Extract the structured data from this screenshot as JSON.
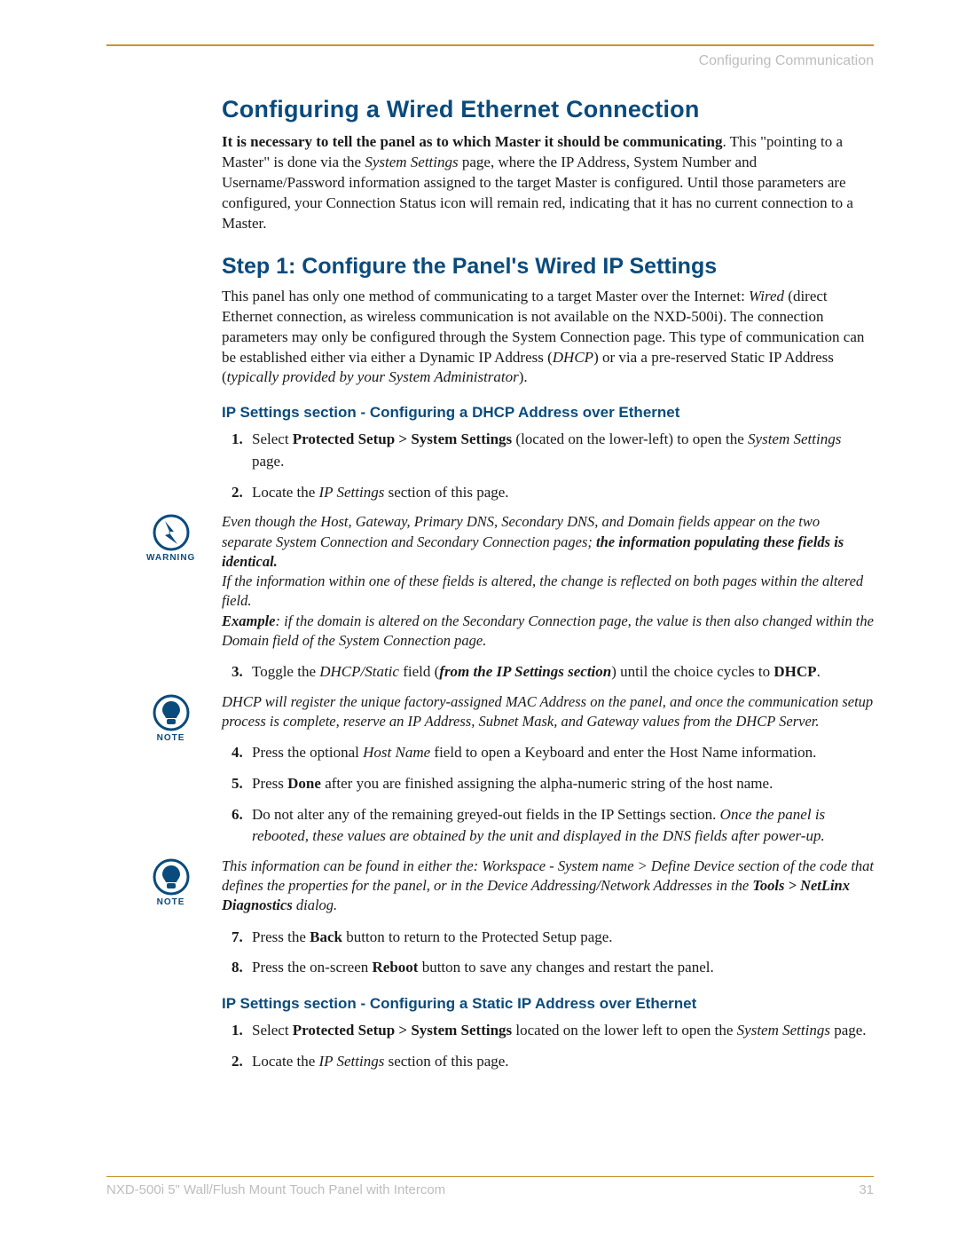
{
  "header": {
    "section": "Configuring Communication"
  },
  "h1": "Configuring a Wired Ethernet Connection",
  "p1_a": "It is necessary to tell the panel as to which Master it should be communicating",
  "p1_b": ". This \"pointing to a Master\" is done via the ",
  "p1_c": "System Settings",
  "p1_d": " page, where the IP Address, System Number and Username/Password information assigned to the target Master is configured. Until those parameters are configured, your Connection Status icon will remain red, indicating that it has no current connection to a Master.",
  "h2": "Step 1: Configure the Panel's Wired IP Settings",
  "p2_a": "This panel has only one method of communicating to a target Master over the Internet: ",
  "p2_b": "Wired",
  "p2_c": " (direct Ethernet connection, as wireless communication is not available on the NXD-500i). The connection parameters may only be configured through the System Connection page. This type of communication can be established either via either a Dynamic IP Address (",
  "p2_d": "DHCP",
  "p2_e": ") or via a pre-reserved Static IP Address (",
  "p2_f": "typically provided by your System Administrator",
  "p2_g": ").",
  "h3a": "IP Settings section - Configuring a DHCP Address over Ethernet",
  "dhcp": {
    "s1_a": "Select ",
    "s1_b": "Protected Setup > System Settings",
    "s1_c": " (located on the lower-left) to open the ",
    "s1_d": "System Settings",
    "s1_e": " page.",
    "s2_a": "Locate the ",
    "s2_b": "IP Settings",
    "s2_c": " section of this page.",
    "s3_a": "Toggle the ",
    "s3_b": "DHCP/Static",
    "s3_c": " field (",
    "s3_d": "from the IP Settings section",
    "s3_e": ") until the choice cycles to ",
    "s3_f": "DHCP",
    "s3_g": ".",
    "s4_a": "Press the optional ",
    "s4_b": "Host Name",
    "s4_c": " field to open a Keyboard and enter the Host Name information.",
    "s5_a": "Press ",
    "s5_b": "Done",
    "s5_c": " after you are finished assigning the alpha-numeric string of the host name.",
    "s6_a": "Do not alter any of the remaining greyed-out fields in the IP Settings section. ",
    "s6_b": "Once the panel is rebooted, these values are obtained by the unit and displayed in the DNS fields after power-up.",
    "s7_a": "Press the ",
    "s7_b": "Back",
    "s7_c": " button to return to the Protected Setup page.",
    "s8_a": "Press the on-screen ",
    "s8_b": "Reboot",
    "s8_c": " button to save any changes and restart the panel."
  },
  "warning": {
    "label": "WARNING",
    "line1": "Even though the Host, Gateway, Primary DNS, Secondary DNS, and Domain fields appear on the two separate System Connection and Secondary Connection pages; ",
    "line1b": "the information populating these fields is identical.",
    "line2": "If the information within one of these fields is altered, the change is reflected on both pages within the altered field.",
    "line3a": "Example",
    "line3b": ": if the domain is altered on the Secondary Connection page, the value is then also changed within the Domain field of the System Connection page."
  },
  "note1": {
    "label": "NOTE",
    "text": "DHCP will register the unique factory-assigned MAC Address on the panel, and once the communication setup process is complete, reserve an IP Address, Subnet Mask, and Gateway values from the DHCP Server."
  },
  "note2": {
    "label": "NOTE",
    "text_a": "This information can be found in either the: Workspace - System name > Define Device section of the code that defines the properties for the panel, or in the Device Addressing/Network Addresses in the ",
    "text_b": "Tools > NetLinx Diagnostics",
    "text_c": " dialog."
  },
  "h3b": "IP Settings section - Configuring a Static IP Address over Ethernet",
  "staticip": {
    "s1_a": "Select ",
    "s1_b": "Protected Setup > System Settings",
    "s1_c": " located on the lower left to open the ",
    "s1_d": "System Settings",
    "s1_e": " page.",
    "s2_a": "Locate the ",
    "s2_b": "IP Settings",
    "s2_c": " section of this page."
  },
  "footer": {
    "left": "NXD-500i 5\" Wall/Flush Mount Touch Panel with Intercom",
    "right": "31"
  }
}
